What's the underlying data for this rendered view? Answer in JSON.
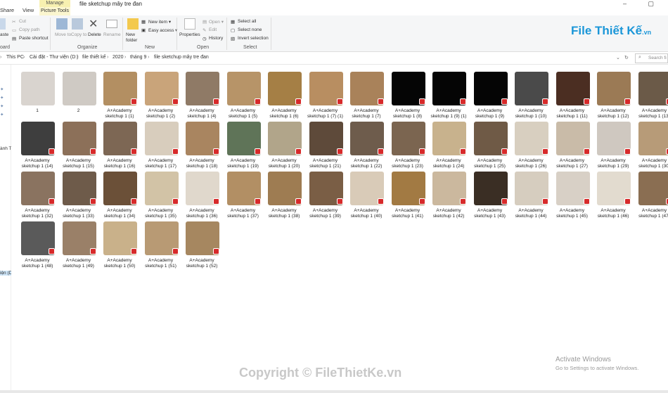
{
  "window": {
    "title": "file sketchup mây tre đan",
    "tabs": [
      "Share",
      "View"
    ],
    "contextual_tab": "Manage",
    "contextual_sub": "Picture Tools",
    "controls": "–  ▢"
  },
  "ribbon": {
    "clipboard": {
      "paste": "aste",
      "cut": "Cut",
      "copy_path": "Copy path",
      "paste_shortcut": "Paste shortcut",
      "group": "oard"
    },
    "organize": {
      "move_to": "Move to",
      "copy_to": "Copy to",
      "delete": "Delete",
      "rename": "Rename",
      "group": "Organize"
    },
    "new": {
      "new_folder": "New folder",
      "new_item": "New item ▾",
      "easy_access": "Easy access ▾",
      "group": "New"
    },
    "open": {
      "properties": "Properties",
      "open": "Open ▾",
      "edit": "Edit",
      "history": "History",
      "group": "Open"
    },
    "select": {
      "select_all": "Select all",
      "select_none": "Select none",
      "invert": "Invert selection",
      "group": "Select"
    }
  },
  "logo": {
    "text": "File Thiết Kế",
    "suffix": ".vn"
  },
  "address": {
    "crumbs": [
      "This PC",
      "Cài đặt - Thư viện (D:)",
      "file thiết kế",
      "2020",
      "tháng 9",
      "file sketchup mây tre đan"
    ],
    "search_placeholder": "Search fi"
  },
  "navpane": {
    "item1": "ành T",
    "item2": "iện (D"
  },
  "files": [
    {
      "name": "1",
      "color": "#d9d4cf"
    },
    {
      "name": "2",
      "color": "#cfcac4"
    },
    {
      "name": "A+Academy sketchup 1 (1)",
      "color": "#b38f62"
    },
    {
      "name": "A+Academy sketchup 1 (2)",
      "color": "#c9a47a"
    },
    {
      "name": "A+Academy sketchup 1 (4)",
      "color": "#8f7a66"
    },
    {
      "name": "A+Academy sketchup 1 (5)",
      "color": "#b79468"
    },
    {
      "name": "A+Academy sketchup 1 (6)",
      "color": "#a57f45"
    },
    {
      "name": "A+Academy sketchup 1 (7) (1)",
      "color": "#b88e61"
    },
    {
      "name": "A+Academy sketchup 1 (7)",
      "color": "#a9825a"
    },
    {
      "name": "A+Academy sketchup 1 (8)",
      "color": "#050505"
    },
    {
      "name": "A+Academy sketchup 1 (9) (1)",
      "color": "#050505"
    },
    {
      "name": "A+Academy sketchup 1 (9)",
      "color": "#050505"
    },
    {
      "name": "A+Academy sketchup 1 (10)",
      "color": "#4a4a4a"
    },
    {
      "name": "A+Academy sketchup 1 (11)",
      "color": "#4b2e22"
    },
    {
      "name": "A+Academy sketchup 1 (12)",
      "color": "#9b7a55"
    },
    {
      "name": "A+Academy sketchup 1 (13)",
      "color": "#6b5a48"
    },
    {
      "name": "A+Academy sketchup 1 (14)",
      "color": "#3e3e3e"
    },
    {
      "name": "A+Academy sketchup 1 (15)",
      "color": "#8c7059"
    },
    {
      "name": "A+Academy sketchup 1 (16)",
      "color": "#7d6754"
    },
    {
      "name": "A+Academy sketchup 1 (17)",
      "color": "#d8cdbd"
    },
    {
      "name": "A+Academy sketchup 1 (18)",
      "color": "#a98560"
    },
    {
      "name": "A+Academy sketchup 1 (19)",
      "color": "#5f7458"
    },
    {
      "name": "A+Academy sketchup 1 (20)",
      "color": "#b1a58a"
    },
    {
      "name": "A+Academy sketchup 1 (21)",
      "color": "#5e4a3a"
    },
    {
      "name": "A+Academy sketchup 1 (22)",
      "color": "#6e5c4c"
    },
    {
      "name": "A+Academy sketchup 1 (23)",
      "color": "#7b6550"
    },
    {
      "name": "A+Academy sketchup 1 (24)",
      "color": "#c8b28d"
    },
    {
      "name": "A+Academy sketchup 1 (25)",
      "color": "#6f5a46"
    },
    {
      "name": "A+Academy sketchup 1 (26)",
      "color": "#d8cfc0"
    },
    {
      "name": "A+Academy sketchup 1 (27)",
      "color": "#c9bba8"
    },
    {
      "name": "A+Academy sketchup 1 (29)",
      "color": "#cfc8c0"
    },
    {
      "name": "A+Academy sketchup 1 (30)",
      "color": "#b79b78"
    },
    {
      "name": "A+Academy sketchup 1 (32)",
      "color": "#8a7360"
    },
    {
      "name": "A+Academy sketchup 1 (33)",
      "color": "#6e5b4a"
    },
    {
      "name": "A+Academy sketchup 1 (34)",
      "color": "#6b5038"
    },
    {
      "name": "A+Academy sketchup 1 (35)",
      "color": "#d2c3a6"
    },
    {
      "name": "A+Academy sketchup 1 (36)",
      "color": "#e0d8cc"
    },
    {
      "name": "A+Academy sketchup 1 (37)",
      "color": "#b28f64"
    },
    {
      "name": "A+Academy sketchup 1 (38)",
      "color": "#9e7c52"
    },
    {
      "name": "A+Academy sketchup 1 (39)",
      "color": "#7a5e45"
    },
    {
      "name": "A+Academy sketchup 1 (40)",
      "color": "#d9cbb8"
    },
    {
      "name": "A+Academy sketchup 1 (41)",
      "color": "#a27a43"
    },
    {
      "name": "A+Academy sketchup 1 (42)",
      "color": "#cbb89e"
    },
    {
      "name": "A+Academy sketchup 1 (43)",
      "color": "#3a2e24"
    },
    {
      "name": "A+Academy sketchup 1 (44)",
      "color": "#d6cdbf"
    },
    {
      "name": "A+Academy sketchup 1 (45)",
      "color": "#d8d0c6"
    },
    {
      "name": "A+Academy sketchup 1 (46)",
      "color": "#e2dbcf"
    },
    {
      "name": "A+Academy sketchup 1 (47)",
      "color": "#8a6e52"
    },
    {
      "name": "A+Academy sketchup 1 (48)",
      "color": "#5a5a5a"
    },
    {
      "name": "A+Academy sketchup 1 (49)",
      "color": "#9a8068"
    },
    {
      "name": "A+Academy sketchup 1 (50)",
      "color": "#c9b18a"
    },
    {
      "name": "A+Academy sketchup 1 (51)",
      "color": "#b89a74"
    },
    {
      "name": "A+Academy sketchup 1 (52)",
      "color": "#a68760"
    }
  ],
  "overlay": {
    "copyright": "Copyright © FileThietKe.vn",
    "activate_title": "Activate Windows",
    "activate_sub": "Go to Settings to activate Windows."
  }
}
